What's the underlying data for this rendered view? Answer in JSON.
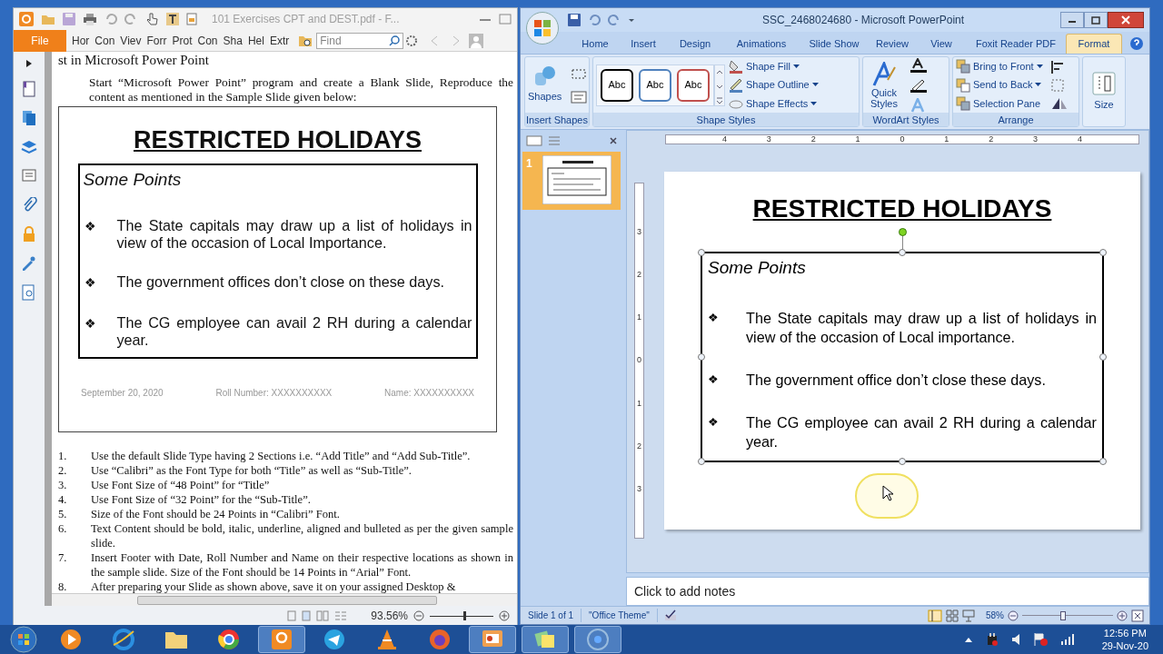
{
  "foxit": {
    "title": "101 Exercises CPT and DEST.pdf - F...",
    "file_tab": "File",
    "menu": [
      "Hor",
      "Con",
      "Viev",
      "Forr",
      "Prot",
      "Con",
      "Sha",
      "Hel",
      "Extr"
    ],
    "search": {
      "placeholder": "Find"
    },
    "heading": "st in Microsoft Power Point",
    "intro": "Start “Microsoft Power Point” program and create a Blank Slide, Reproduce the content as mentioned in the Sample Slide given below:",
    "sample_slide": {
      "title": "RESTRICTED HOLIDAYS",
      "subtitle": "Some Points",
      "bullet": "❖",
      "bullets": [
        "The State capitals may draw up a list of holidays in view of the occasion of Local Importance.",
        "The government offices don’t close on these days.",
        "The CG employee can avail 2 RH during a calendar year."
      ],
      "footer": [
        "September 20, 2020",
        "Roll Number: XXXXXXXXXX",
        "Name: XXXXXXXXXX"
      ]
    },
    "steps": [
      {
        "number": "1.",
        "text": "Use the default Slide Type having 2 Sections i.e. “Add Title” and “Add Sub-Title”."
      },
      {
        "number": "2.",
        "text": "Use “Calibri” as the Font Type for both “Title” as well as “Sub-Title”."
      },
      {
        "number": "3.",
        "text": "Use Font Size of “48 Point” for “Title”"
      },
      {
        "number": "4.",
        "text": "Use Font Size of “32 Point” for the “Sub-Title”."
      },
      {
        "number": "5.",
        "text": "Size of the Font should be 24 Points in “Calibri” Font."
      },
      {
        "number": "6.",
        "text": "Text Content should be bold, italic, underline, aligned and bulleted as per the given sample slide."
      },
      {
        "number": "7.",
        "text": "Insert Footer with Date, Roll Number and Name on their respective locations as shown in the sample slide. Size of the Font should be 14 Points in “Arial” Font."
      },
      {
        "number": "8.",
        "text": "After preparing your Slide as shown above, save it on your assigned Desktop &"
      }
    ],
    "zoom": "93.56%",
    "zoom_slider": {
      "level": 0.55
    }
  },
  "powerpoint": {
    "title": "SSC_2468024680 - Microsoft PowerPoint",
    "tabs": [
      {
        "label": "Home",
        "selected": false
      },
      {
        "label": "Insert",
        "selected": false
      },
      {
        "label": "Design",
        "selected": false
      },
      {
        "label": "Animations",
        "selected": false
      },
      {
        "label": "Slide Show",
        "selected": false
      },
      {
        "label": "Review",
        "selected": false
      },
      {
        "label": "View",
        "selected": false
      },
      {
        "label": "Foxit Reader PDF",
        "selected": false
      },
      {
        "label": "Format",
        "selected": true
      }
    ],
    "ribbon": {
      "shapes": "Shapes",
      "style_samples": [
        {
          "label": "Abc",
          "color": "#000000"
        },
        {
          "label": "Abc",
          "color": "#4f81bd"
        },
        {
          "label": "Abc",
          "color": "#c0504d"
        }
      ],
      "shape_commands": [
        {
          "label": "Shape Fill",
          "dropdown": true
        },
        {
          "label": "Shape Outline",
          "dropdown": true
        },
        {
          "label": "Shape Effects",
          "dropdown": true
        }
      ],
      "quick_styles": "Quick Styles",
      "arrange_commands": [
        {
          "label": "Bring to Front",
          "dropdown": true
        },
        {
          "label": "Send to Back",
          "dropdown": true
        },
        {
          "label": "Selection Pane",
          "dropdown": false
        }
      ],
      "size": "Size",
      "groups": [
        "Insert Shapes",
        "Shape Styles",
        "WordArt Styles",
        "Arrange"
      ]
    },
    "thumbnail_number": "1",
    "ruler_h": [
      "4",
      "3",
      "2",
      "1",
      "0",
      "1",
      "2",
      "3",
      "4"
    ],
    "ruler_v": [
      "3",
      "2",
      "1",
      "0",
      "1",
      "2",
      "3"
    ],
    "slide": {
      "title": "RESTRICTED HOLIDAYS",
      "subtitle": "Some Points",
      "bullet": "❖",
      "bullets": [
        "The State capitals may draw up a list of holidays in view of the occasion of Local importance.",
        "The government office don’t close these days.",
        "The CG employee can avail 2 RH during a calendar year."
      ]
    },
    "notes_placeholder": "Click to add notes",
    "status": [
      "Slide 1 of 1",
      "\"Office Theme\""
    ],
    "zoom": "58%",
    "zoom_slider": {
      "level": 0.45
    }
  },
  "taskbar": {
    "time": "12:56 PM",
    "date": "29-Nov-20"
  }
}
